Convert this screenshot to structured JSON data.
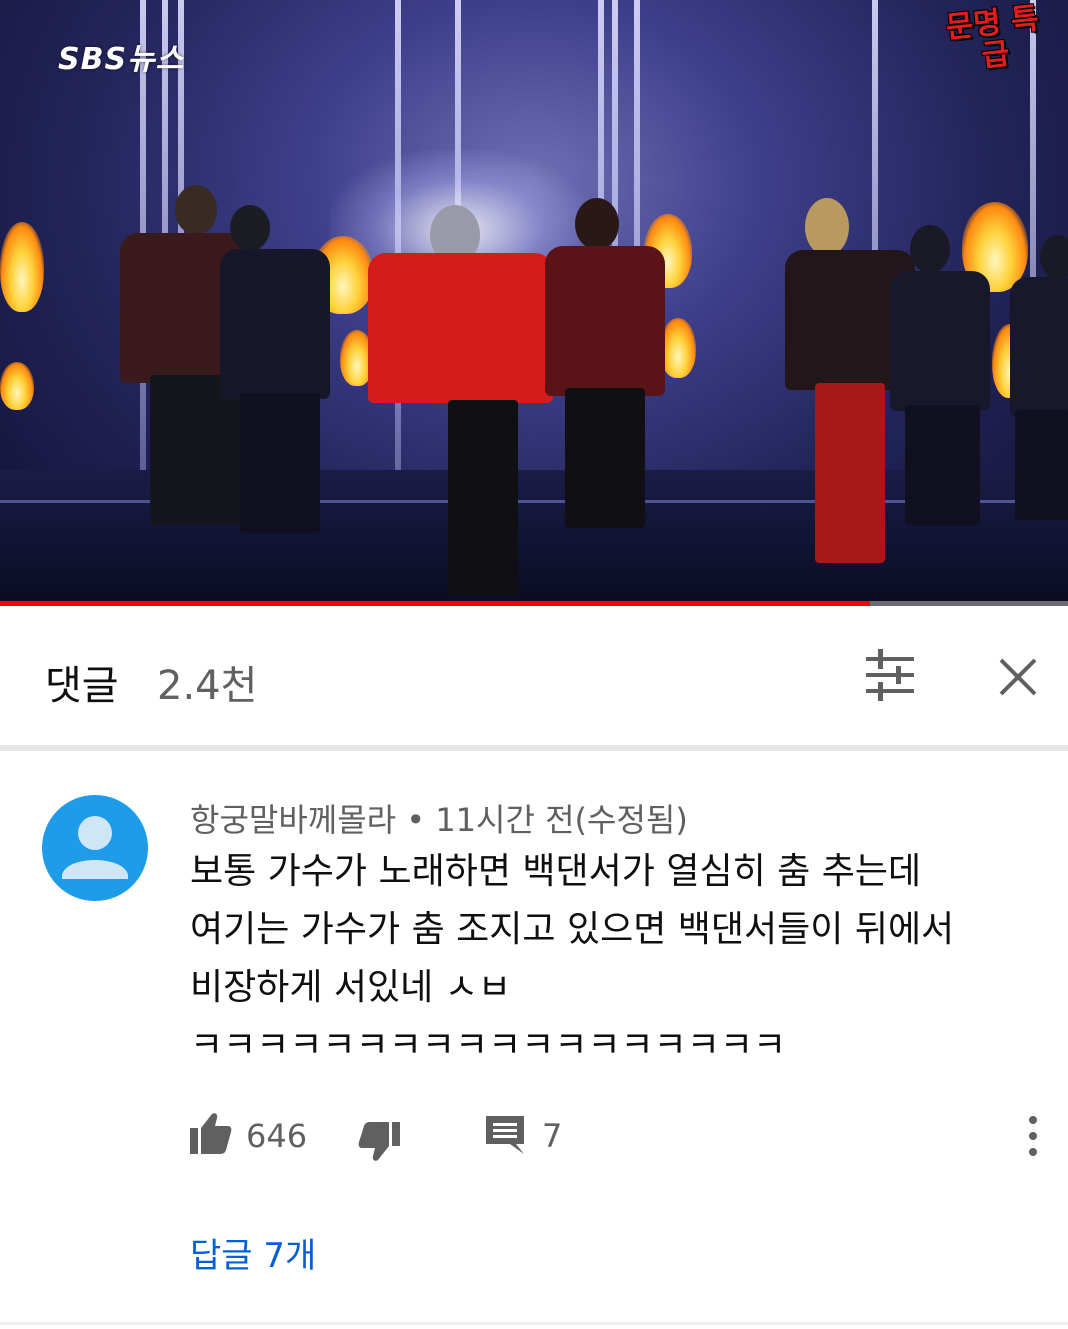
{
  "video": {
    "brand_logo": "SBS뉴스",
    "badge_text": "문명 특급",
    "progress_fraction": 0.815,
    "colors": {
      "progress": "#ff0000"
    }
  },
  "comments_header": {
    "title": "댓글",
    "count": "2.4천",
    "filter_icon": "sort-filter-icon",
    "close_icon": "close-icon"
  },
  "comment": {
    "author": "항궁말바께몰라",
    "separator": "•",
    "time": "11시간 전(수정됨)",
    "text_lines": [
      "보통 가수가 노래하면 백댄서가 열심히 춤 추는데",
      "여기는 가수가 춤 조지고 있으면 백댄서들이 뒤에서",
      "비장하게 서있네 ㅅㅂ",
      "ㅋㅋㅋㅋㅋㅋㅋㅋㅋㅋㅋㅋㅋㅋㅋㅋㅋㅋ"
    ],
    "likes": "646",
    "replies_count": "7",
    "replies_link": "답글 7개",
    "avatar_color": "#1e9be9",
    "link_color": "#065fd4"
  }
}
